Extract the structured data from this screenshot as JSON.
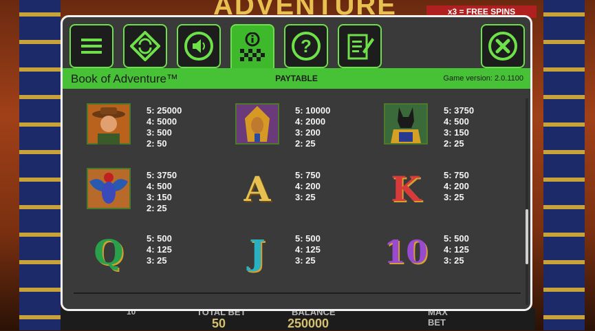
{
  "background": {
    "game_title": "ADVENTURE",
    "free_spins_text": "x3 = FREE SPINS",
    "total_bet_label": "TOTAL BET",
    "total_bet_value": "50",
    "balance_label": "BALANCE",
    "balance_value": "250000",
    "max_bet_label": "MAX BET",
    "lines_value": "10"
  },
  "tabs": [
    {
      "name": "menu",
      "icon": "hamburger-icon",
      "active": false
    },
    {
      "name": "autoplay",
      "icon": "autoplay-icon",
      "active": false
    },
    {
      "name": "sound",
      "icon": "speaker-icon",
      "active": false
    },
    {
      "name": "paytable",
      "icon": "paytable-icon",
      "active": true
    },
    {
      "name": "help",
      "icon": "question-icon",
      "active": false
    },
    {
      "name": "rules",
      "icon": "document-icon",
      "active": false
    }
  ],
  "close_icon": "close-icon",
  "header": {
    "game_name": "Book of Adventure™",
    "section_title": "PAYTABLE",
    "version": "Game version: 2.0.1100"
  },
  "colors": {
    "accent": "#47c236",
    "dialog_bg": "#3a3a3a",
    "text": "#f4f4f4"
  },
  "symbols": [
    {
      "symbol": "explorer",
      "pays": [
        "5: 25000",
        "4: 5000",
        "3: 500",
        "2: 50"
      ]
    },
    {
      "symbol": "pharaoh",
      "pays": [
        "5: 10000",
        "4: 2000",
        "3: 200",
        "2: 25"
      ]
    },
    {
      "symbol": "anubis",
      "pays": [
        "5: 3750",
        "4: 500",
        "3: 150",
        "2: 25"
      ]
    },
    {
      "symbol": "scarab",
      "pays": [
        "5: 3750",
        "4: 500",
        "3: 150",
        "2: 25"
      ]
    },
    {
      "symbol": "A",
      "pays": [
        "5: 750",
        "4: 200",
        "3: 25"
      ]
    },
    {
      "symbol": "K",
      "pays": [
        "5: 750",
        "4: 200",
        "3: 25"
      ]
    },
    {
      "symbol": "Q",
      "pays": [
        "5: 500",
        "4: 125",
        "3: 25"
      ]
    },
    {
      "symbol": "J",
      "pays": [
        "5: 500",
        "4: 125",
        "3: 25"
      ]
    },
    {
      "symbol": "10",
      "pays": [
        "5: 500",
        "4: 125",
        "3: 25"
      ]
    }
  ]
}
